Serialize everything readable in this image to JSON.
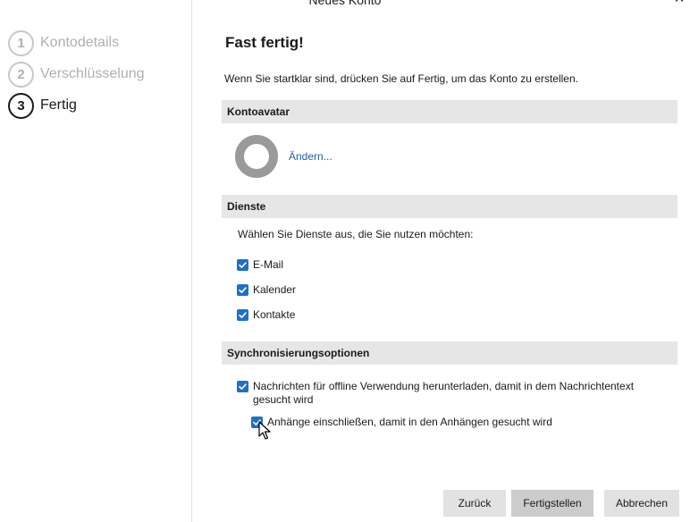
{
  "window": {
    "title": "Neues Konto",
    "close_icon": "close-icon"
  },
  "steps": [
    {
      "number": "1",
      "label": "Kontodetails",
      "state": "inactive"
    },
    {
      "number": "2",
      "label": "Verschlüsselung",
      "state": "inactive"
    },
    {
      "number": "3",
      "label": "Fertig",
      "state": "active"
    }
  ],
  "main": {
    "heading": "Fast fertig!",
    "intro": "Wenn Sie startklar sind, drücken Sie auf Fertig, um das Konto zu erstellen."
  },
  "avatar_section": {
    "title": "Kontoavatar",
    "change_link": "Ändern..."
  },
  "services_section": {
    "title": "Dienste",
    "description": "Wählen Sie Dienste aus, die Sie nutzen möchten:",
    "items": [
      {
        "label": "E-Mail",
        "checked": true
      },
      {
        "label": "Kalender",
        "checked": true
      },
      {
        "label": "Kontakte",
        "checked": true
      }
    ]
  },
  "sync_section": {
    "title": "Synchronisierungsoptionen",
    "offline_label": "Nachrichten für offline Verwendung herunterladen, damit in dem Nachrichtentext gesucht wird",
    "offline_checked": true,
    "attachments_label": "Anhänge einschließen, damit in den Anhängen gesucht wird",
    "attachments_checked": true
  },
  "buttons": {
    "back": "Zurück",
    "finish": "Fertigstellen",
    "cancel": "Abbrechen"
  },
  "colors": {
    "checkbox": "#1e6fc9",
    "link": "#1f5fa8",
    "section_bar": "#e6e6e6"
  }
}
